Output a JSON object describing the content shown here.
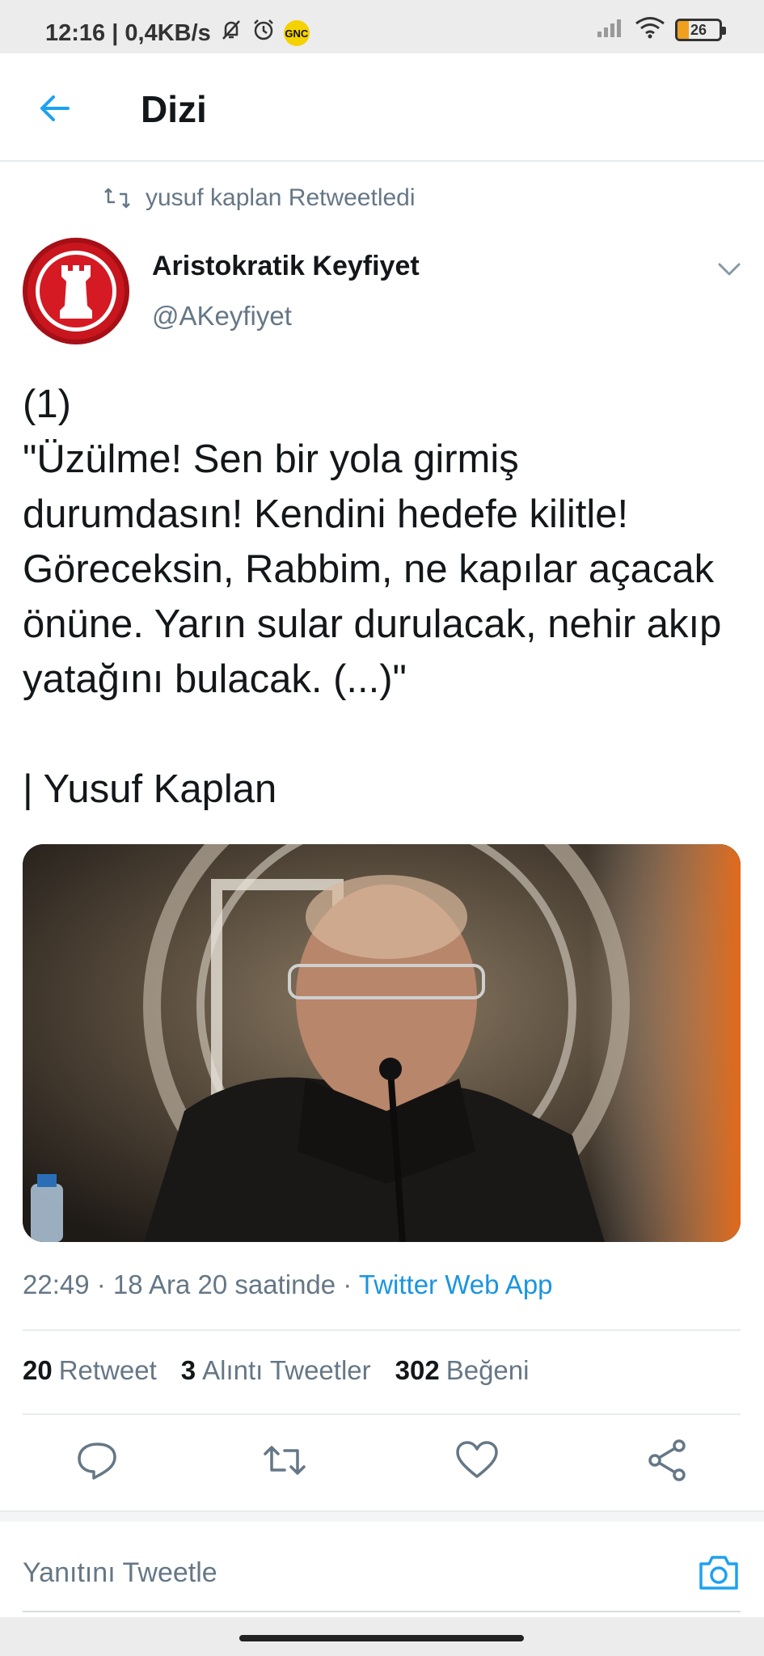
{
  "status_bar": {
    "time_speed": "12:16 | 0,4KB/s",
    "carrier_badge": "GNC",
    "battery": "26",
    "battery_level": 0.26
  },
  "header": {
    "title": "Dizi"
  },
  "tweet": {
    "retweet_context": "yusuf kaplan Retweetledi",
    "author_name": "Aristokratik Keyfiyet",
    "author_handle": "@AKeyfiyet",
    "text": "(1)\n\"Üzülme! Sen bir yola girmiş durumdasın! Kendini hedefe kilitle! Göreceksin, Rabbim, ne kapılar açacak önüne. Yarın sular durulacak, nehir akıp yatağını bulacak. (...)\"\n\n| Yusuf Kaplan",
    "meta_prefix": "22:49 · 18 Ara 20 saatinde · ",
    "source": "Twitter Web App",
    "stats": {
      "retweet_count": "20",
      "retweet_label": "Retweet",
      "quote_count": "3",
      "quote_label": "Alıntı Tweetler",
      "like_count": "302",
      "like_label": "Beğeni"
    }
  },
  "reply": {
    "placeholder": "Yanıtını Tweetle"
  },
  "colors": {
    "accent": "#1b95e0",
    "secondary_text": "#657786",
    "divider": "#e6ecf0"
  },
  "icons": {
    "back": "arrow-left-icon",
    "retweet_context": "retweet-icon",
    "caret": "chevron-down-icon",
    "reply": "reply-icon",
    "retweet": "retweet-icon",
    "like": "heart-icon",
    "share": "share-icon",
    "camera": "camera-icon"
  }
}
